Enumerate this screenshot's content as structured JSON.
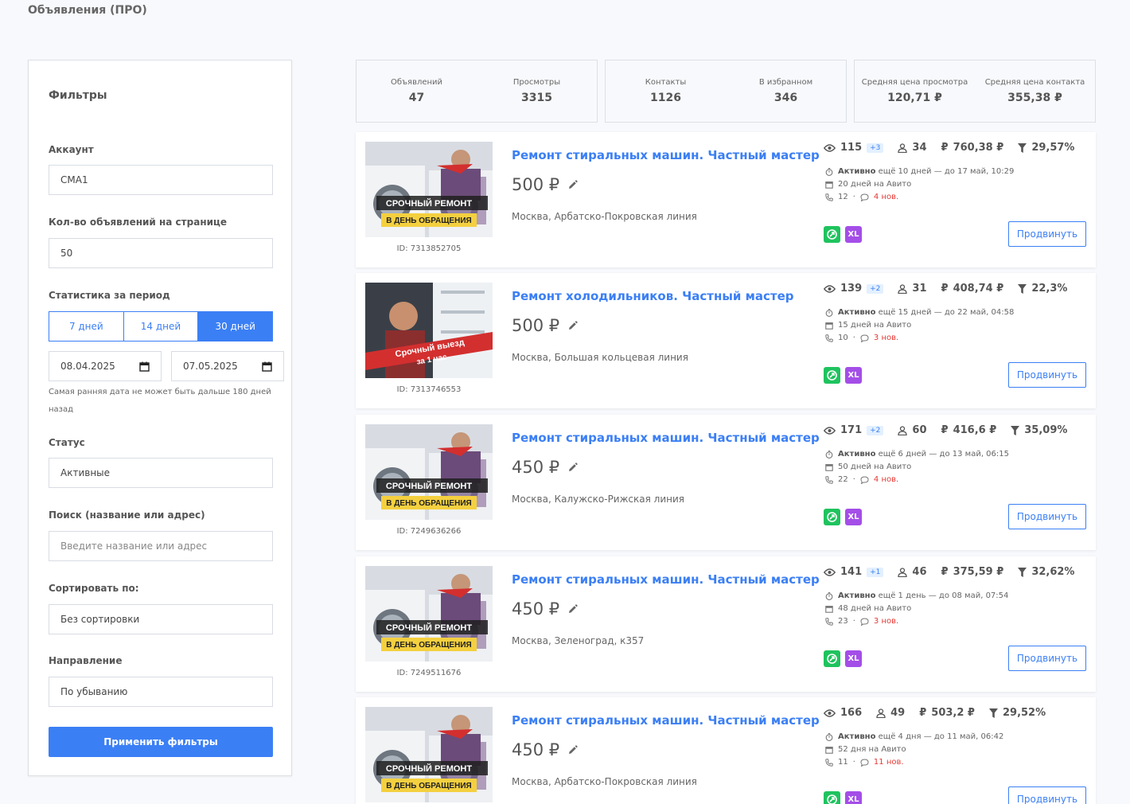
{
  "page": {
    "title": "Объявления (ПРО)"
  },
  "filters": {
    "title": "Фильтры",
    "account_label": "Аккаунт",
    "account_value": "СМА1",
    "per_page_label": "Кол-во объявлений на странице",
    "per_page_value": "50",
    "period_label": "Статистика за период",
    "periods": [
      "7 дней",
      "14 дней",
      "30 дней"
    ],
    "active_period": "30 дней",
    "date_from": "08.04.2025",
    "date_to": "07.05.2025",
    "date_hint": "Самая ранняя дата не может быть дальше 180 дней назад",
    "status_label": "Статус",
    "status_value": "Активные",
    "search_label": "Поиск (название или адрес)",
    "search_placeholder": "Введите название или адрес",
    "sort_label": "Сортировать по:",
    "sort_value": "Без сортировки",
    "direction_label": "Направление",
    "direction_value": "По убыванию",
    "apply_label": "Применить фильтры"
  },
  "stats": [
    {
      "label": "Объявлений",
      "value": "47"
    },
    {
      "label": "Просмотры",
      "value": "3315"
    },
    {
      "label": "Контакты",
      "value": "1126"
    },
    {
      "label": "В избранном",
      "value": "346"
    },
    {
      "label": "Средняя цена просмотра",
      "value": "120,71 ₽"
    },
    {
      "label": "Средняя цена контакта",
      "value": "355,38 ₽"
    }
  ],
  "listings": [
    {
      "id": "ID: 7313852705",
      "title": "Ремонт стиральных машин. Частный мастер",
      "price": "500 ₽",
      "address": "Москва, Арбатско-Покровская линия",
      "views": "115",
      "views_delta": "+3",
      "contacts": "34",
      "cost": "760,38 ₽",
      "conversion": "29,57%",
      "status_word": "Активно",
      "status_rest": "ещё 10 дней — до 17 май, 10:29",
      "days_on": "20 дней на Авито",
      "calls": "12",
      "messages": "4 нов.",
      "promote_label": "Продвинуть",
      "xl_label": "XL",
      "image_type": "washer",
      "image_line1": "СРОЧНЫЙ РЕМОНТ",
      "image_line2": "В ДЕНЬ ОБРАЩЕНИЯ"
    },
    {
      "id": "ID: 7313746553",
      "title": "Ремонт холодильников. Частный мастер",
      "price": "500 ₽",
      "address": "Москва, Большая кольцевая линия",
      "views": "139",
      "views_delta": "+2",
      "contacts": "31",
      "cost": "408,74 ₽",
      "conversion": "22,3%",
      "status_word": "Активно",
      "status_rest": "ещё 15 дней — до 22 май, 04:58",
      "days_on": "15 дней на Авито",
      "calls": "10",
      "messages": "3 нов.",
      "promote_label": "Продвинуть",
      "xl_label": "XL",
      "image_type": "fridge",
      "image_line1": "Срочный выезд",
      "image_line2": "за 1 час"
    },
    {
      "id": "ID: 7249636266",
      "title": "Ремонт стиральных машин. Частный мастер",
      "price": "450 ₽",
      "address": "Москва, Калужско-Рижская линия",
      "views": "171",
      "views_delta": "+2",
      "contacts": "60",
      "cost": "416,6 ₽",
      "conversion": "35,09%",
      "status_word": "Активно",
      "status_rest": "ещё 6 дней — до 13 май, 06:15",
      "days_on": "50 дней на Авито",
      "calls": "22",
      "messages": "4 нов.",
      "promote_label": "Продвинуть",
      "xl_label": "XL",
      "image_type": "washer",
      "image_line1": "СРОЧНЫЙ РЕМОНТ",
      "image_line2": "В ДЕНЬ ОБРАЩЕНИЯ"
    },
    {
      "id": "ID: 7249511676",
      "title": "Ремонт стиральных машин. Частный мастер",
      "price": "450 ₽",
      "address": "Москва, Зеленоград, к357",
      "views": "141",
      "views_delta": "+1",
      "contacts": "46",
      "cost": "375,59 ₽",
      "conversion": "32,62%",
      "status_word": "Активно",
      "status_rest": "ещё 1 день — до 08 май, 07:54",
      "days_on": "48 дней на Авито",
      "calls": "23",
      "messages": "3 нов.",
      "promote_label": "Продвинуть",
      "xl_label": "XL",
      "image_type": "washer",
      "image_line1": "СРОЧНЫЙ РЕМОНТ",
      "image_line2": "В ДЕНЬ ОБРАЩЕНИЯ"
    },
    {
      "id": "",
      "title": "Ремонт стиральных машин. Частный мастер",
      "price": "450 ₽",
      "address": "Москва, Арбатско-Покровская линия",
      "views": "166",
      "views_delta": "",
      "contacts": "49",
      "cost": "503,2 ₽",
      "conversion": "29,52%",
      "status_word": "Активно",
      "status_rest": "ещё 4 дня — до 11 май, 06:42",
      "days_on": "52 дня на Авито",
      "calls": "11",
      "messages": "11 нов.",
      "promote_label": "Продвинуть",
      "xl_label": "XL",
      "image_type": "washer",
      "image_line1": "СРОЧНЫЙ РЕМОНТ",
      "image_line2": "В ДЕНЬ ОБРАЩЕНИЯ"
    }
  ]
}
